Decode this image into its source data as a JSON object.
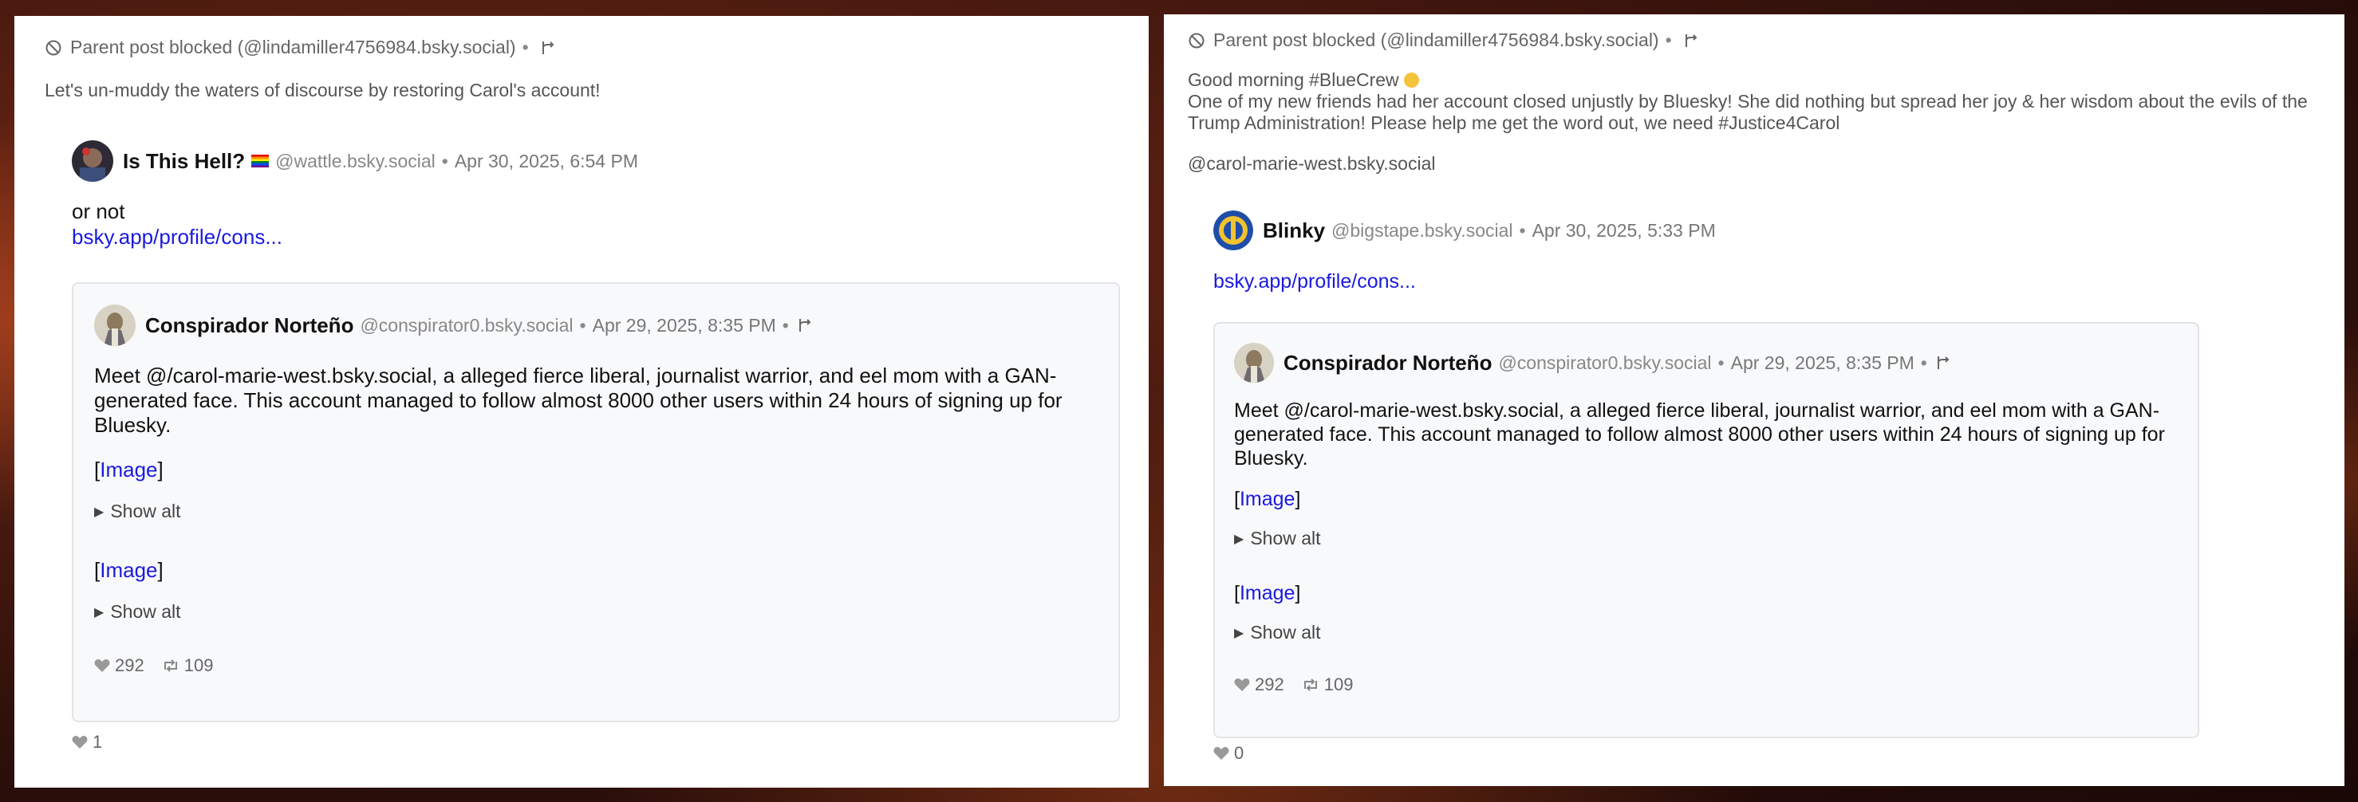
{
  "left": {
    "blocked_text": "Parent post blocked (@lindamiller4756984.bsky.social)",
    "dot": "•",
    "post_text": "Let's un-muddy the waters of discourse by restoring Carol's account!",
    "author": {
      "name": "Is This Hell?",
      "handle": "@wattle.bsky.social",
      "time": "Apr 30, 2025, 6:54 PM"
    },
    "reply_line1": "or not",
    "reply_link": "bsky.app/profile/cons...",
    "quote": {
      "name": "Conspirador Norteño",
      "handle": "@conspirator0.bsky.social",
      "time": "Apr 29, 2025, 8:35 PM",
      "body": "Meet @/carol-marie-west.bsky.social, a alleged fierce liberal, journalist warrior, and eel mom with a GAN-generated face. This account managed to follow almost 8000 other users within 24 hours of signing up for Bluesky.",
      "image_label": "Image",
      "show_alt": "Show alt",
      "likes": "292",
      "reposts": "109"
    },
    "likes": "1"
  },
  "right": {
    "blocked_text": "Parent post blocked (@lindamiller4756984.bsky.social)",
    "dot": "•",
    "post_line1": "Good morning #BlueCrew",
    "post_line2": "One of my new friends had her account closed unjustly by Bluesky! She did nothing but spread her joy & her wisdom about the evils of the Trump Administration! Please help me get the word out, we need #Justice4Carol",
    "post_line3": "@carol-marie-west.bsky.social",
    "author": {
      "name": "Blinky",
      "handle": "@bigstape.bsky.social",
      "time": "Apr 30, 2025, 5:33 PM"
    },
    "reply_link": "bsky.app/profile/cons...",
    "quote": {
      "name": "Conspirador Norteño",
      "handle": "@conspirator0.bsky.social",
      "time": "Apr 29, 2025, 8:35 PM",
      "body": "Meet @/carol-marie-west.bsky.social, a alleged fierce liberal, journalist warrior, and eel mom with a GAN-generated face. This account managed to follow almost 8000 other users within 24 hours of signing up for Bluesky.",
      "image_label": "Image",
      "show_alt": "Show alt",
      "likes": "292",
      "reposts": "109"
    },
    "likes": "0"
  },
  "icons": {
    "blocked": "blocked-icon",
    "thread": "thread-icon",
    "heart": "heart-icon",
    "repost": "repost-icon"
  },
  "colors": {
    "link": "#1a1adf",
    "card_bg": "#f8f9fb",
    "card_border": "#e2e4e8"
  }
}
